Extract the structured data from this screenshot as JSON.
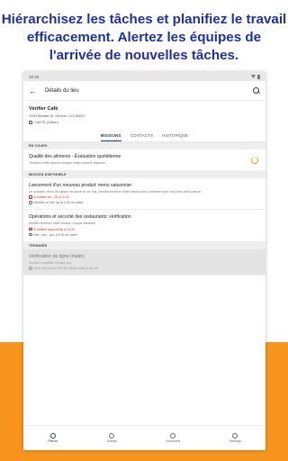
{
  "promo": {
    "headline": "Hiérarchisez les tâches et planifiez le travail efficacement. Alertez les équipes de l'arrivée de nouvelles tâches."
  },
  "status_bar": {
    "time": "10:20"
  },
  "app_bar": {
    "title": "Détails du lieu"
  },
  "place": {
    "name": "Vérifier Café",
    "address": "1000 Market St, Denver, CO 80202",
    "map_label": "CARTE (3,8km)"
  },
  "tabs": [
    {
      "label": "MISSIONS"
    },
    {
      "label": "CONTACTS"
    },
    {
      "label": "HISTORIQUE"
    }
  ],
  "sections": {
    "in_progress": "EN COURS",
    "available": "MISSION DISPONIBLE",
    "done": "TERMINÉE"
  },
  "missions": {
    "in_progress": [
      {
        "title": "Qualité des aliments - Évaluation quotidienne",
        "desc": "Terminez cette mission chaque matin avant le déjeuner"
      }
    ],
    "available": [
      {
        "title": "Lancement d'un nouveau produit: menu saisonnier",
        "desc": "Le nouveau menu de saison est lancé le 1er mai. Veuillez terminer cette mission pour confirmer que vous êtes prêt à lancer.",
        "date": "À réaliser au : 28 à 10:30",
        "repeat": "Monthly on the 1st at 9:00 du matin"
      },
      {
        "title": "Opérations et sécurité des restaurants: vérification",
        "desc": "Veuillez terminer cette mission chaque semaine",
        "date": "À réaliser aujourd'hui à 10:30",
        "repeat": "mar., mer., jeu. à 9:00 du matin"
      }
    ],
    "done": [
      {
        "title": "Vérification de ligne (matin)",
        "desc": "Veuillez compléter chaque jour",
        "repeat": "Tous les jours à 9:00 de l'après-midi ou du soir"
      }
    ]
  },
  "bottom_nav": [
    {
      "label": "Places",
      "icon": "location-pin-icon"
    },
    {
      "label": "Activity",
      "icon": "clock-icon"
    },
    {
      "label": "Annonces",
      "icon": "globe-icon"
    },
    {
      "label": "Settings",
      "icon": "gear-icon"
    }
  ],
  "colors": {
    "accent": "#1f3a8a",
    "promo_text": "#1f2fa8",
    "brand_orange": "#f7941d",
    "alert": "#d9342b"
  }
}
